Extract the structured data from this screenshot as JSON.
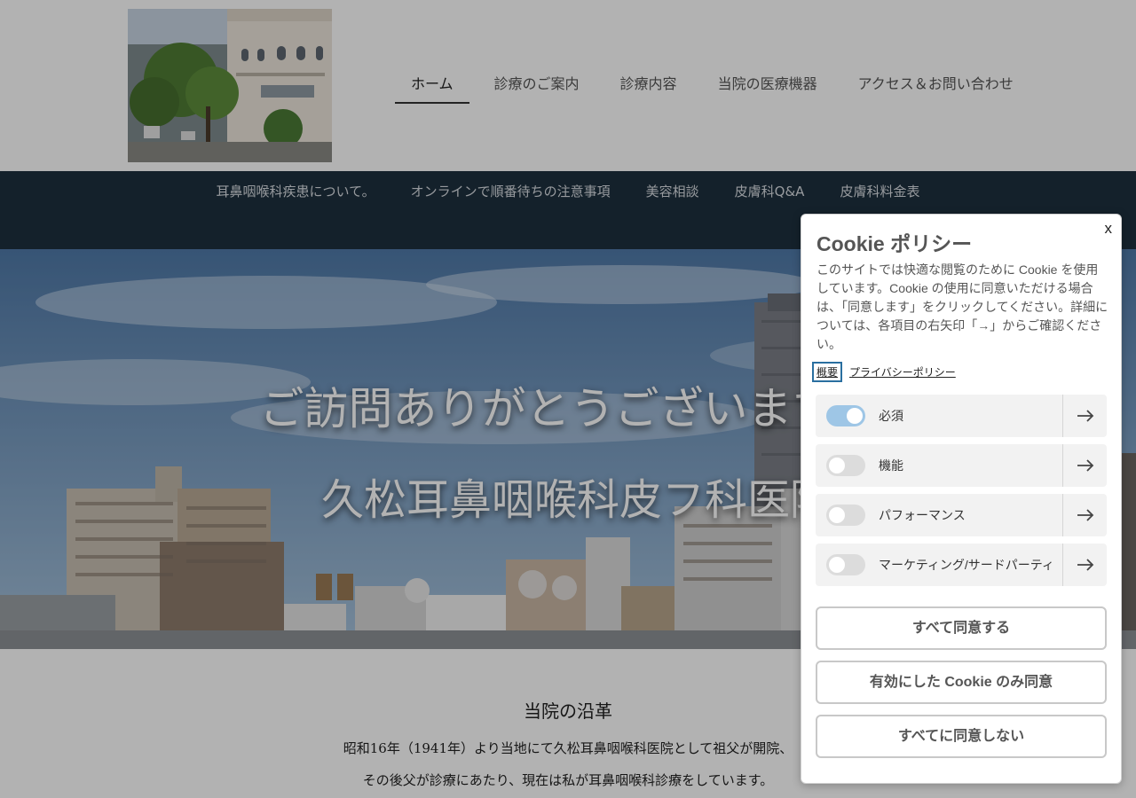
{
  "header": {
    "nav": [
      {
        "label": "ホーム",
        "active": true
      },
      {
        "label": "診療のご案内",
        "active": false
      },
      {
        "label": "診療内容",
        "active": false
      },
      {
        "label": "当院の医療機器",
        "active": false
      },
      {
        "label": "アクセス＆お問い合わせ",
        "active": false
      }
    ]
  },
  "subnav": {
    "items": [
      "耳鼻咽喉科疾患について。",
      "オンラインで順番待ちの注意事項",
      "美容相談",
      "皮膚科Q&A",
      "皮膚科料金表"
    ]
  },
  "hero": {
    "line1": "ご訪問ありがとうございます。",
    "line2": "久松耳鼻咽喉科皮フ科医院"
  },
  "content": {
    "history_title": "当院の沿革",
    "history_line1": "昭和16年（1941年）より当地にて久松耳鼻咽喉科医院として祖父が開院、",
    "history_line2": "その後父が診療にあたり、現在は私が耳鼻咽喉科診療をしています。"
  },
  "cookie": {
    "close_label": "x",
    "title": "Cookie ポリシー",
    "description": "このサイトでは快適な閲覧のために Cookie を使用しています。Cookie の使用に同意いただける場合は、「同意します」をクリックしてください。詳細については、各項目の右矢印「→」からご確認ください。",
    "link_overview": "概要",
    "link_privacy": "プライバシーポリシー",
    "categories": [
      {
        "label": "必須",
        "enabled": true
      },
      {
        "label": "機能",
        "enabled": false
      },
      {
        "label": "パフォーマンス",
        "enabled": false
      },
      {
        "label": "マーケティング/サードパーティ",
        "enabled": false
      }
    ],
    "buttons": {
      "accept_all": "すべて同意する",
      "accept_selected": "有効にした Cookie のみ同意",
      "reject_all": "すべてに同意しない"
    }
  },
  "icons": {
    "arrow": "arrow-right-icon",
    "close": "close-icon"
  },
  "colors": {
    "subnav_bg": "#1e303e",
    "toggle_on": "#9ec6e6",
    "focus_outline": "#2a6fa0"
  }
}
